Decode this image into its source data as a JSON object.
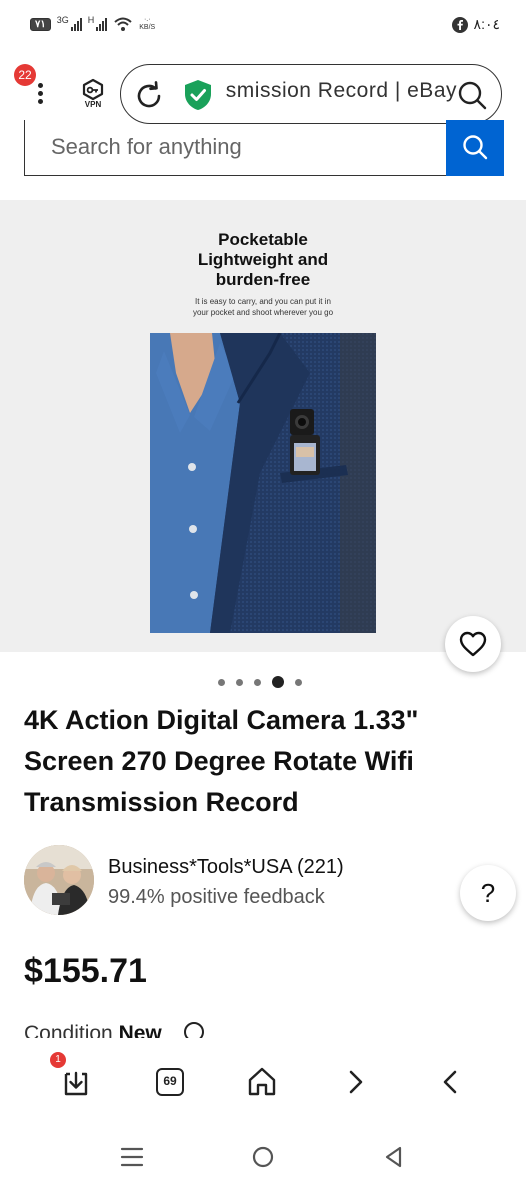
{
  "status_bar": {
    "battery": "٧١",
    "network_1": "3G",
    "network_2": "H",
    "speed_unit": "KB/S",
    "time": "٨:٠٤",
    "social_icon": "facebook-icon"
  },
  "browser": {
    "tab_count_badge": "22",
    "vpn_label": "VPN",
    "url_text": "Transmission Record | eBay",
    "download_badge": "1",
    "tabs_count": "69"
  },
  "ebay": {
    "search_placeholder": "Search for anything"
  },
  "gallery": {
    "promo_title_lines": [
      "Pocketable",
      "Lightweight and",
      "burden-free"
    ],
    "promo_sub_lines": [
      "It is easy to carry, and you can put it in",
      "your pocket and shoot wherever you go"
    ],
    "image_count": 5,
    "active_index": 3
  },
  "listing": {
    "title": "4K Action Digital Camera 1.33\" Screen 270 Degree Rotate Wifi Transmission Record",
    "seller_name": "Business*Tools*USA (221)",
    "seller_feedback": "99.4% positive feedback",
    "price": "$155.71",
    "condition_label": "Condition",
    "condition_value": "New"
  },
  "colors": {
    "ebay_blue": "#0064d2",
    "badge_red": "#e53935",
    "shield_green": "#1aa15a"
  }
}
